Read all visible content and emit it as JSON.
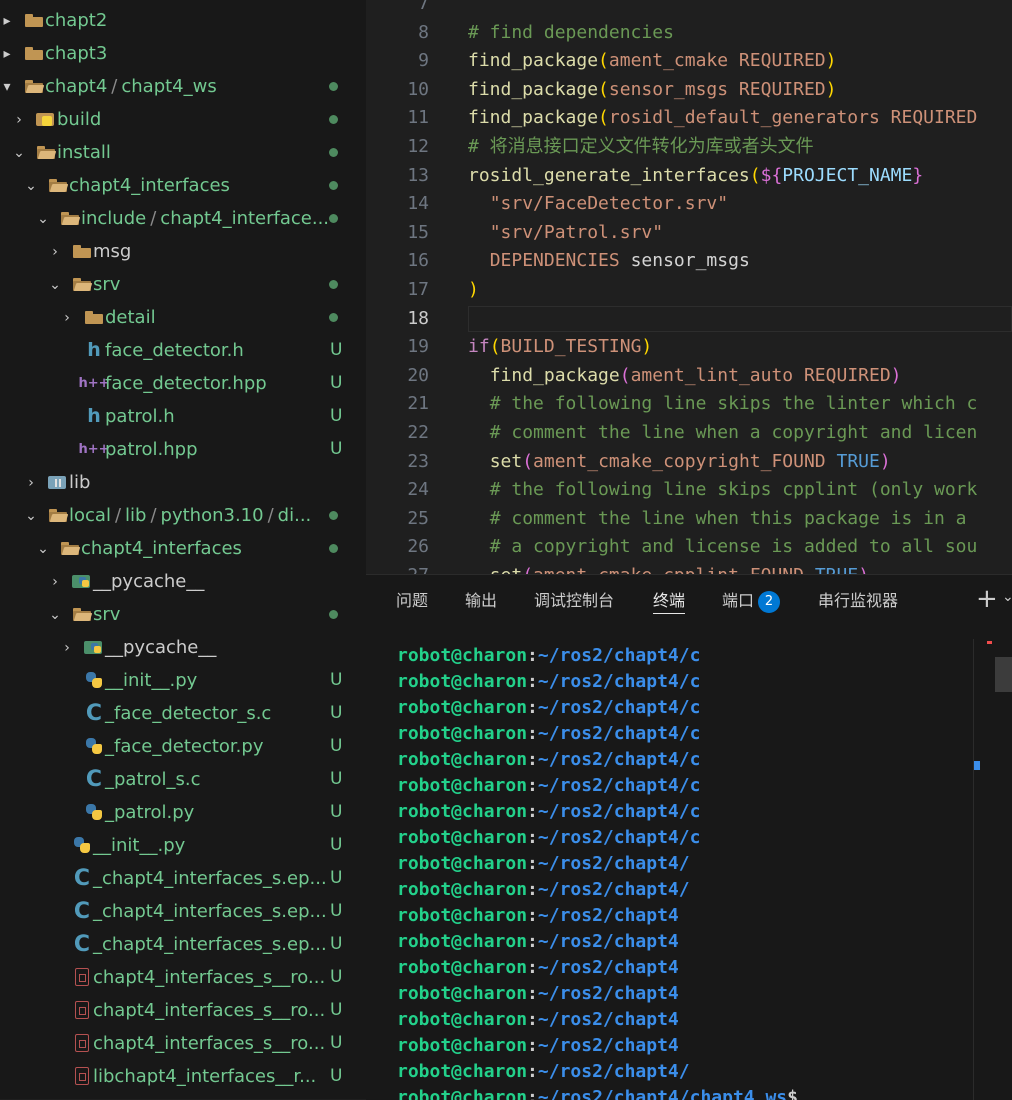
{
  "explorer": {
    "items": [
      {
        "label": "chapt2",
        "icon": "folder-icon",
        "chevron": "▸",
        "green": true
      },
      {
        "label": "chapt3",
        "icon": "folder-icon",
        "chevron": "▸",
        "green": true
      },
      {
        "label": "chapt4",
        "sep": "/",
        "label2": "chapt4_ws",
        "icon": "folder-open-icon",
        "chevron": "▾",
        "green": true,
        "dot": true
      },
      {
        "label": "build",
        "icon": "build-folder-icon",
        "chevron": "›",
        "green": true,
        "dot": true
      },
      {
        "label": "install",
        "icon": "folder-open-icon",
        "chevron": "⌄",
        "green": true,
        "dot": true
      },
      {
        "label": "chapt4_interfaces",
        "icon": "folder-open-icon",
        "chevron": "⌄",
        "green": true,
        "dot": true
      },
      {
        "label": "include",
        "sep": "/",
        "label2": "chapt4_interface...",
        "icon": "folder-open-icon",
        "chevron": "⌄",
        "green": true,
        "dot": true
      },
      {
        "label": "msg",
        "icon": "folder-icon",
        "chevron": "›",
        "green": false
      },
      {
        "label": "srv",
        "icon": "folder-open-icon",
        "chevron": "⌄",
        "green": true,
        "dot": true
      },
      {
        "label": "detail",
        "icon": "folder-icon",
        "chevron": "›",
        "green": true,
        "dot": true
      },
      {
        "label": "face_detector.h",
        "icon": "c-header-icon",
        "green": true,
        "badge": "U"
      },
      {
        "label": "face_detector.hpp",
        "icon": "cpp-header-icon",
        "green": true,
        "badge": "U"
      },
      {
        "label": "patrol.h",
        "icon": "c-header-icon",
        "green": true,
        "badge": "U"
      },
      {
        "label": "patrol.hpp",
        "icon": "cpp-header-icon",
        "green": true,
        "badge": "U"
      },
      {
        "label": "lib",
        "icon": "lib-folder-icon",
        "chevron": "›",
        "green": false
      },
      {
        "label": "local",
        "sep": "/",
        "label2": "lib",
        "sep2": "/",
        "label3": "python3.10",
        "sep3": "/",
        "label4": "di...",
        "icon": "folder-open-icon",
        "chevron": "⌄",
        "green": true,
        "dot": true
      },
      {
        "label": "chapt4_interfaces",
        "icon": "folder-open-icon",
        "chevron": "⌄",
        "green": true,
        "dot": true
      },
      {
        "label": "__pycache__",
        "icon": "pycache-folder-icon",
        "chevron": "›",
        "green": false
      },
      {
        "label": "srv",
        "icon": "folder-open-icon",
        "chevron": "⌄",
        "green": true,
        "dot": true
      },
      {
        "label": "__pycache__",
        "icon": "pycache-folder-icon",
        "chevron": "›",
        "green": false
      },
      {
        "label": "__init__.py",
        "icon": "python-file-icon",
        "green": true,
        "badge": "U"
      },
      {
        "label": "_face_detector_s.c",
        "icon": "c-file-icon",
        "green": true,
        "badge": "U"
      },
      {
        "label": "_face_detector.py",
        "icon": "python-file-icon",
        "green": true,
        "badge": "U"
      },
      {
        "label": "_patrol_s.c",
        "icon": "c-file-icon",
        "green": true,
        "badge": "U"
      },
      {
        "label": "_patrol.py",
        "icon": "python-file-icon",
        "green": true,
        "badge": "U"
      },
      {
        "label": "__init__.py",
        "icon": "python-file-icon",
        "green": true,
        "badge": "U"
      },
      {
        "label": "_chapt4_interfaces_s.ep...",
        "icon": "c-file-icon",
        "green": true,
        "badge": "U"
      },
      {
        "label": "_chapt4_interfaces_s.ep...",
        "icon": "c-file-icon",
        "green": true,
        "badge": "U"
      },
      {
        "label": "_chapt4_interfaces_s.ep...",
        "icon": "c-file-icon",
        "green": true,
        "badge": "U"
      },
      {
        "label": "chapt4_interfaces_s__ro...",
        "icon": "binary-file-icon",
        "green": true,
        "badge": "U"
      },
      {
        "label": "chapt4_interfaces_s__ro...",
        "icon": "binary-file-icon",
        "green": true,
        "badge": "U"
      },
      {
        "label": "chapt4_interfaces_s__ro...",
        "icon": "binary-file-icon",
        "green": true,
        "badge": "U"
      },
      {
        "label": "libchapt4_interfaces__r...",
        "icon": "binary-file-icon",
        "green": true,
        "badge": "U"
      }
    ]
  },
  "editor": {
    "active_line": "18",
    "lines": [
      {
        "n": "7",
        "tokens": []
      },
      {
        "n": "8",
        "tokens": [
          {
            "t": "# find dependencies",
            "c": "com"
          }
        ]
      },
      {
        "n": "9",
        "tokens": [
          {
            "t": "find_package",
            "c": "fn"
          },
          {
            "t": "(",
            "c": "p"
          },
          {
            "t": "ament_cmake REQUIRED",
            "c": "arg"
          },
          {
            "t": ")",
            "c": "p"
          }
        ]
      },
      {
        "n": "10",
        "tokens": [
          {
            "t": "find_package",
            "c": "fn"
          },
          {
            "t": "(",
            "c": "p"
          },
          {
            "t": "sensor_msgs REQUIRED",
            "c": "arg"
          },
          {
            "t": ")",
            "c": "p"
          }
        ]
      },
      {
        "n": "11",
        "tokens": [
          {
            "t": "find_package",
            "c": "fn"
          },
          {
            "t": "(",
            "c": "p"
          },
          {
            "t": "rosidl_default_generators REQUIRED",
            "c": "arg"
          }
        ]
      },
      {
        "n": "12",
        "tokens": [
          {
            "t": "# 将消息接口定义文件转化为库或者头文件",
            "c": "com"
          }
        ]
      },
      {
        "n": "13",
        "tokens": [
          {
            "t": "rosidl_generate_interfaces",
            "c": "fn"
          },
          {
            "t": "(",
            "c": "p"
          },
          {
            "t": "${",
            "c": "br"
          },
          {
            "t": "PROJECT_NAME",
            "c": "var"
          },
          {
            "t": "}",
            "c": "br"
          }
        ]
      },
      {
        "n": "14",
        "tokens": [
          {
            "t": "  ",
            "c": "txt"
          },
          {
            "t": "\"srv/FaceDetector.srv\"",
            "c": "str"
          }
        ]
      },
      {
        "n": "15",
        "tokens": [
          {
            "t": "  ",
            "c": "txt"
          },
          {
            "t": "\"srv/Patrol.srv\"",
            "c": "str"
          }
        ]
      },
      {
        "n": "16",
        "tokens": [
          {
            "t": "  ",
            "c": "txt"
          },
          {
            "t": "DEPENDENCIES",
            "c": "arg"
          },
          {
            "t": " sensor_msgs",
            "c": "w"
          }
        ]
      },
      {
        "n": "17",
        "tokens": [
          {
            "t": ")",
            "c": "p"
          }
        ]
      },
      {
        "n": "18",
        "tokens": []
      },
      {
        "n": "19",
        "tokens": [
          {
            "t": "if",
            "c": "kw"
          },
          {
            "t": "(",
            "c": "p"
          },
          {
            "t": "BUILD_TESTING",
            "c": "arg"
          },
          {
            "t": ")",
            "c": "p"
          }
        ]
      },
      {
        "n": "20",
        "tokens": [
          {
            "t": "  ",
            "c": "txt"
          },
          {
            "t": "find_package",
            "c": "fn"
          },
          {
            "t": "(",
            "c": "br"
          },
          {
            "t": "ament_lint_auto REQUIRED",
            "c": "arg"
          },
          {
            "t": ")",
            "c": "br"
          }
        ]
      },
      {
        "n": "21",
        "tokens": [
          {
            "t": "  ",
            "c": "txt"
          },
          {
            "t": "# the following line skips the linter which c",
            "c": "com"
          }
        ]
      },
      {
        "n": "22",
        "tokens": [
          {
            "t": "  ",
            "c": "txt"
          },
          {
            "t": "# comment the line when a copyright and licen",
            "c": "com"
          }
        ]
      },
      {
        "n": "23",
        "tokens": [
          {
            "t": "  ",
            "c": "txt"
          },
          {
            "t": "set",
            "c": "fn"
          },
          {
            "t": "(",
            "c": "br"
          },
          {
            "t": "ament_cmake_copyright_FOUND",
            "c": "arg"
          },
          {
            "t": " ",
            "c": "txt"
          },
          {
            "t": "TRUE",
            "c": "blue"
          },
          {
            "t": ")",
            "c": "br"
          }
        ]
      },
      {
        "n": "24",
        "tokens": [
          {
            "t": "  ",
            "c": "txt"
          },
          {
            "t": "# the following line skips cpplint (only work",
            "c": "com"
          }
        ]
      },
      {
        "n": "25",
        "tokens": [
          {
            "t": "  ",
            "c": "txt"
          },
          {
            "t": "# comment the line when this package is in a ",
            "c": "com"
          }
        ]
      },
      {
        "n": "26",
        "tokens": [
          {
            "t": "  ",
            "c": "txt"
          },
          {
            "t": "# a copyright and license is added to all sou",
            "c": "com"
          }
        ]
      },
      {
        "n": "27",
        "tokens": [
          {
            "t": "  ",
            "c": "txt"
          },
          {
            "t": "set",
            "c": "fn"
          },
          {
            "t": "(",
            "c": "br"
          },
          {
            "t": "ament_cmake_cpplint_FOUND",
            "c": "arg"
          },
          {
            "t": " ",
            "c": "txt"
          },
          {
            "t": "TRUE",
            "c": "blue"
          },
          {
            "t": ")",
            "c": "br"
          }
        ]
      }
    ]
  },
  "panel": {
    "tabs": [
      {
        "label": "问题",
        "active": false
      },
      {
        "label": "输出",
        "active": false
      },
      {
        "label": "调试控制台",
        "active": false
      },
      {
        "label": "终端",
        "active": true
      },
      {
        "label": "端口",
        "active": false,
        "badge": "2"
      },
      {
        "label": "串行监视器",
        "active": false
      }
    ],
    "new_terminal": "+",
    "terminal_lines": [
      {
        "user": "robot@charon",
        "colon": ":",
        "path": "~/ros2/chapt4/c"
      },
      {
        "user": "robot@charon",
        "colon": ":",
        "path": "~/ros2/chapt4/c"
      },
      {
        "user": "robot@charon",
        "colon": ":",
        "path": "~/ros2/chapt4/c"
      },
      {
        "user": "robot@charon",
        "colon": ":",
        "path": "~/ros2/chapt4/c"
      },
      {
        "user": "robot@charon",
        "colon": ":",
        "path": "~/ros2/chapt4/c"
      },
      {
        "user": "robot@charon",
        "colon": ":",
        "path": "~/ros2/chapt4/c"
      },
      {
        "user": "robot@charon",
        "colon": ":",
        "path": "~/ros2/chapt4/c"
      },
      {
        "user": "robot@charon",
        "colon": ":",
        "path": "~/ros2/chapt4/c"
      },
      {
        "user": "robot@charon",
        "colon": ":",
        "path": "~/ros2/chapt4/"
      },
      {
        "user": "robot@charon",
        "colon": ":",
        "path": "~/ros2/chapt4/"
      },
      {
        "user": "robot@charon",
        "colon": ":",
        "path": "~/ros2/chapt4"
      },
      {
        "user": "robot@charon",
        "colon": ":",
        "path": "~/ros2/chapt4"
      },
      {
        "user": "robot@charon",
        "colon": ":",
        "path": "~/ros2/chapt4"
      },
      {
        "user": "robot@charon",
        "colon": ":",
        "path": "~/ros2/chapt4"
      },
      {
        "user": "robot@charon",
        "colon": ":",
        "path": "~/ros2/chapt4"
      },
      {
        "user": "robot@charon",
        "colon": ":",
        "path": "~/ros2/chapt4"
      },
      {
        "user": "robot@charon",
        "colon": ":",
        "path": "~/ros2/chapt4/"
      },
      {
        "user": "robot@charon",
        "colon": ":",
        "path": "~/ros2/chapt4/chapt4_ws",
        "suffix": "$"
      }
    ]
  },
  "colors": {
    "git_untracked": "#73c991",
    "accent_blue": "#0078d4",
    "terminal_user": "#23d18b",
    "terminal_path": "#3b8eea"
  }
}
